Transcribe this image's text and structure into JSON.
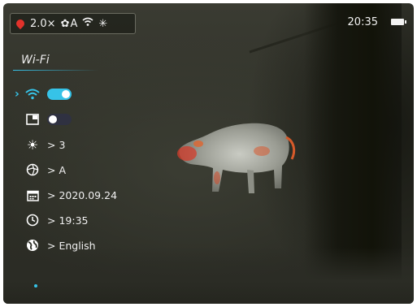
{
  "status_bar": {
    "zoom": "2.0×",
    "mode": "A",
    "time": "20:35"
  },
  "menu": {
    "title": "Wi-Fi",
    "items": [
      {
        "icon": "wifi-icon",
        "type": "toggle",
        "state": "on"
      },
      {
        "icon": "picture-in-picture-icon",
        "type": "toggle",
        "state": "off"
      },
      {
        "icon": "brightness-icon",
        "value": "> 3"
      },
      {
        "icon": "calibration-icon",
        "value": "> A"
      },
      {
        "icon": "calendar-icon",
        "value": "> 2020.09.24"
      },
      {
        "icon": "clock-icon",
        "value": "> 19:35"
      },
      {
        "icon": "globe-icon",
        "value": "> English"
      }
    ]
  },
  "colors": {
    "accent": "#36c3e8",
    "palette_icon": "#e2322b"
  }
}
